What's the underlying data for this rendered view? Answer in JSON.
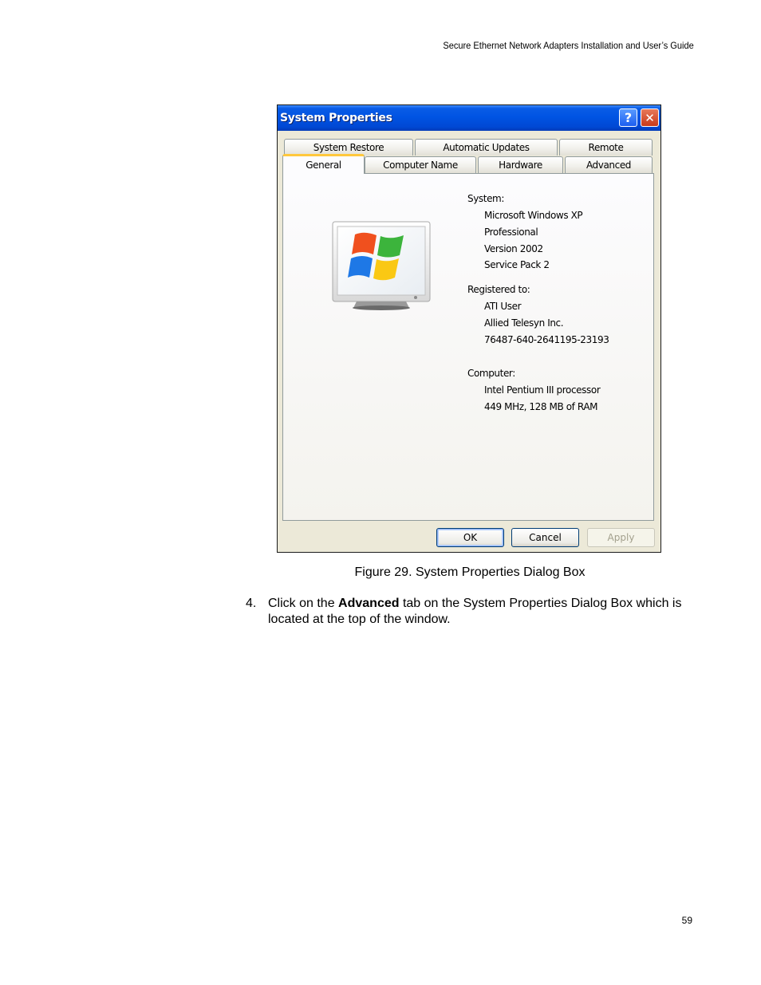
{
  "page": {
    "running_header": "Secure Ethernet Network Adapters Installation and User’s Guide",
    "page_number": "59"
  },
  "dialog": {
    "title": "System Properties",
    "help_glyph": "?",
    "close_glyph": "✕",
    "tabs_row1": [
      "System Restore",
      "Automatic Updates",
      "Remote"
    ],
    "tabs_row2": [
      "General",
      "Computer Name",
      "Hardware",
      "Advanced"
    ],
    "active_tab": "General",
    "system_heading": "System:",
    "system_lines": [
      "Microsoft Windows XP",
      "Professional",
      "Version 2002",
      "Service Pack 2"
    ],
    "registered_heading": "Registered to:",
    "registered_lines": [
      "ATI User",
      "Allied Telesyn Inc.",
      "76487-640-2641195-23193"
    ],
    "computer_heading": "Computer:",
    "computer_lines": [
      "Intel Pentium III processor",
      "449 MHz, 128 MB of RAM"
    ],
    "buttons": {
      "ok": "OK",
      "cancel": "Cancel",
      "apply": "Apply"
    },
    "icons": {
      "help": "help-icon",
      "close": "close-icon",
      "logo": "windows-logo-icon"
    },
    "colors": {
      "titlebar": "#0054e3",
      "active_tab_accent": "#ffc83c",
      "dialog_face": "#ece9d8"
    }
  },
  "caption": "Figure 29. System Properties Dialog Box",
  "step": {
    "number": "4.",
    "text_before": "Click on the ",
    "bold": "Advanced",
    "text_after": " tab on the System Properties Dialog Box which is located at the top of the window."
  }
}
